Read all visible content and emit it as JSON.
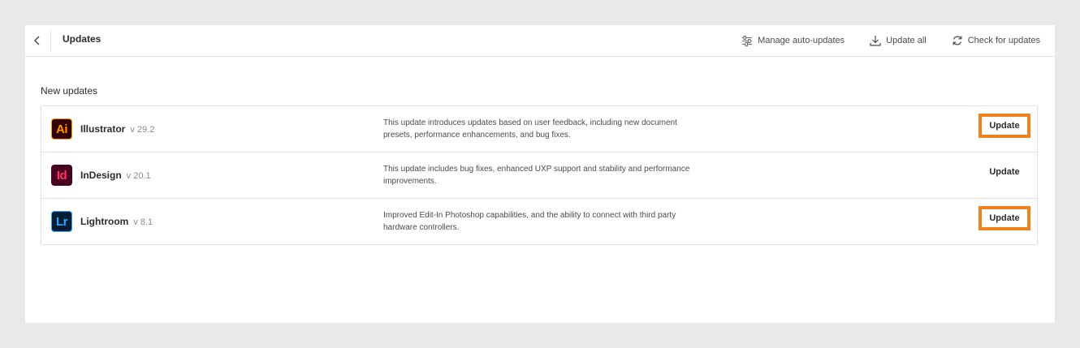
{
  "header": {
    "title": "Updates",
    "back_icon": "chevron-left-icon",
    "actions": [
      {
        "label": "Manage auto-updates",
        "icon": "sliders-icon"
      },
      {
        "label": "Update all",
        "icon": "download-icon"
      },
      {
        "label": "Check for updates",
        "icon": "refresh-icon"
      }
    ]
  },
  "section": {
    "title": "New updates"
  },
  "apps": [
    {
      "abbr": "Ai",
      "name": "Illustrator",
      "version": "v 29.2",
      "description": "This update introduces updates based on user feedback, including new document presets, performance enhancements, and bug fixes.",
      "button": "Update",
      "highlighted": true
    },
    {
      "abbr": "Id",
      "name": "InDesign",
      "version": "v 20.1",
      "description": "This update includes bug fixes, enhanced UXP support and stability and performance improvements.",
      "button": "Update",
      "highlighted": false
    },
    {
      "abbr": "Lr",
      "name": "Lightroom",
      "version": "v 8.1",
      "description": "Improved Edit-In Photoshop capabilities, and the ability to connect with third party hardware controllers.",
      "button": "Update",
      "highlighted": true
    }
  ],
  "colors": {
    "highlight": "#f0821e",
    "illustrator_bg": "#330000",
    "illustrator_fg": "#ff9a00",
    "indesign_bg": "#49021f",
    "indesign_fg": "#ff3366",
    "lightroom_bg": "#001e36",
    "lightroom_fg": "#31a8ff"
  }
}
